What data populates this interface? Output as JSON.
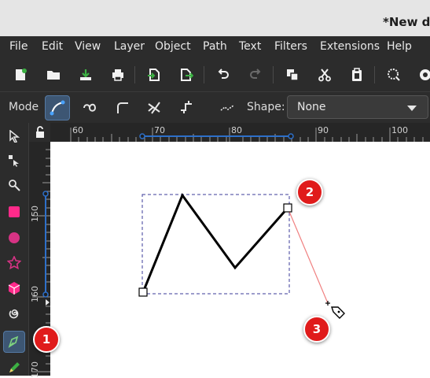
{
  "window": {
    "title": "*New do"
  },
  "menu": [
    "File",
    "Edit",
    "View",
    "Layer",
    "Object",
    "Path",
    "Text",
    "Filters",
    "Extensions",
    "Help"
  ],
  "toolbar": {
    "icons": [
      "new-document-icon",
      "open-icon",
      "save-icon",
      "print-icon",
      "import-icon",
      "export-icon",
      "undo-icon",
      "redo-icon",
      "duplicate-icon",
      "cut-icon",
      "paste-icon",
      "zoom-icon"
    ]
  },
  "tool_controls": {
    "mode_label": "Mode",
    "shape_label": "Shape:",
    "shape_value": "None"
  },
  "rulers": {
    "horizontal": [
      "60",
      "70",
      "80",
      "90",
      "100"
    ],
    "vertical": [
      "150",
      "160",
      "170"
    ]
  },
  "badges": [
    "1",
    "2",
    "3"
  ],
  "colors": {
    "badge": "#e01b1b",
    "active_tool": "#3d5673",
    "chrome": "#2c2c2c",
    "guide_line": "#f08080",
    "selection_box": "#3b3b9a"
  }
}
